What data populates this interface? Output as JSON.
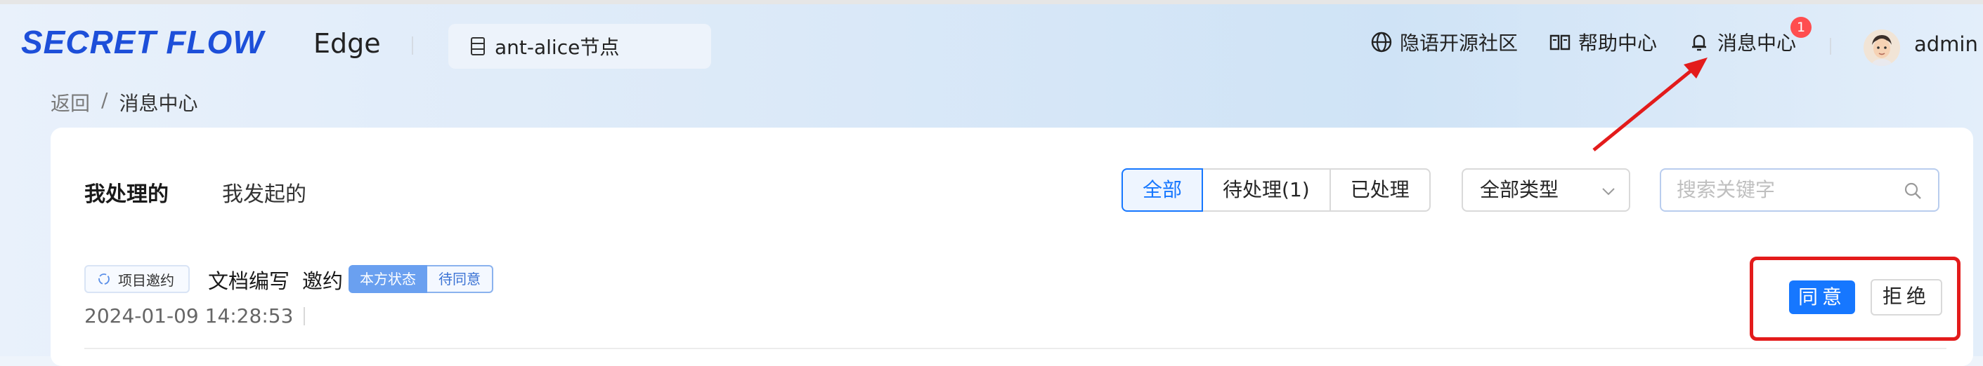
{
  "header": {
    "logo_text": "SECRET FLOW",
    "brand": "Edge",
    "node_label": "ant-alice节点",
    "nav": {
      "community": "隐语开源社区",
      "help": "帮助中心",
      "messages": "消息中心",
      "messages_badge": "1"
    },
    "user": "admin"
  },
  "breadcrumb": {
    "back": "返回",
    "separator": "/",
    "current": "消息中心"
  },
  "tabs": {
    "handled_by_me": "我处理的",
    "initiated_by_me": "我发起的"
  },
  "filters": {
    "status": [
      "全部",
      "待处理(1)",
      "已处理"
    ],
    "type_select": "全部类型",
    "search_placeholder": "搜索关键字"
  },
  "messages": [
    {
      "tag": "项目邀约",
      "project": "文档编写",
      "action": "邀约",
      "status_label": "本方状态",
      "status_value": "待同意",
      "time": "2024-01-09 14:28:53",
      "agree": "同意",
      "reject": "拒绝"
    }
  ],
  "colors": {
    "accent": "#1677ff",
    "logo": "#1d4fd9",
    "badge": "#ff4d4f",
    "annotation": "#e31b1b"
  }
}
